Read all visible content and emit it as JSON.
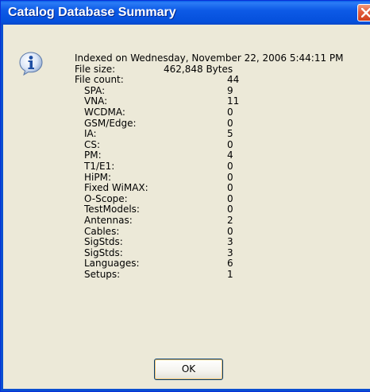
{
  "window": {
    "title": "Catalog Database Summary"
  },
  "icons": {
    "info": "info-icon",
    "close": "close-icon"
  },
  "summary": {
    "indexed_line": "Indexed on Wednesday, November 22, 2006 5:44:11 PM",
    "file_size_label": "File size:",
    "file_size_value": "462,848 Bytes",
    "file_count_label": "File count:",
    "file_count_value": "44",
    "items": [
      {
        "label": "SPA:",
        "value": "9"
      },
      {
        "label": "VNA:",
        "value": "11"
      },
      {
        "label": "WCDMA:",
        "value": "0"
      },
      {
        "label": "GSM/Edge:",
        "value": "0"
      },
      {
        "label": "IA:",
        "value": "5"
      },
      {
        "label": "CS:",
        "value": "0"
      },
      {
        "label": "PM:",
        "value": "4"
      },
      {
        "label": "T1/E1:",
        "value": "0"
      },
      {
        "label": "HiPM:",
        "value": "0"
      },
      {
        "label": "Fixed WiMAX:",
        "value": "0"
      },
      {
        "label": "O-Scope:",
        "value": "0"
      },
      {
        "label": "TestModels:",
        "value": "0"
      },
      {
        "label": "Antennas:",
        "value": "2"
      },
      {
        "label": "Cables:",
        "value": "0"
      },
      {
        "label": "SigStds:",
        "value": "3"
      },
      {
        "label": "SigStds:",
        "value": "3"
      },
      {
        "label": "Languages:",
        "value": "6"
      },
      {
        "label": "Setups:",
        "value": "1"
      }
    ]
  },
  "buttons": {
    "ok_label": "OK"
  },
  "colors": {
    "titlebar": "#0a5fe8",
    "dialog_bg": "#ece9d8",
    "close_button": "#e15b3b"
  }
}
